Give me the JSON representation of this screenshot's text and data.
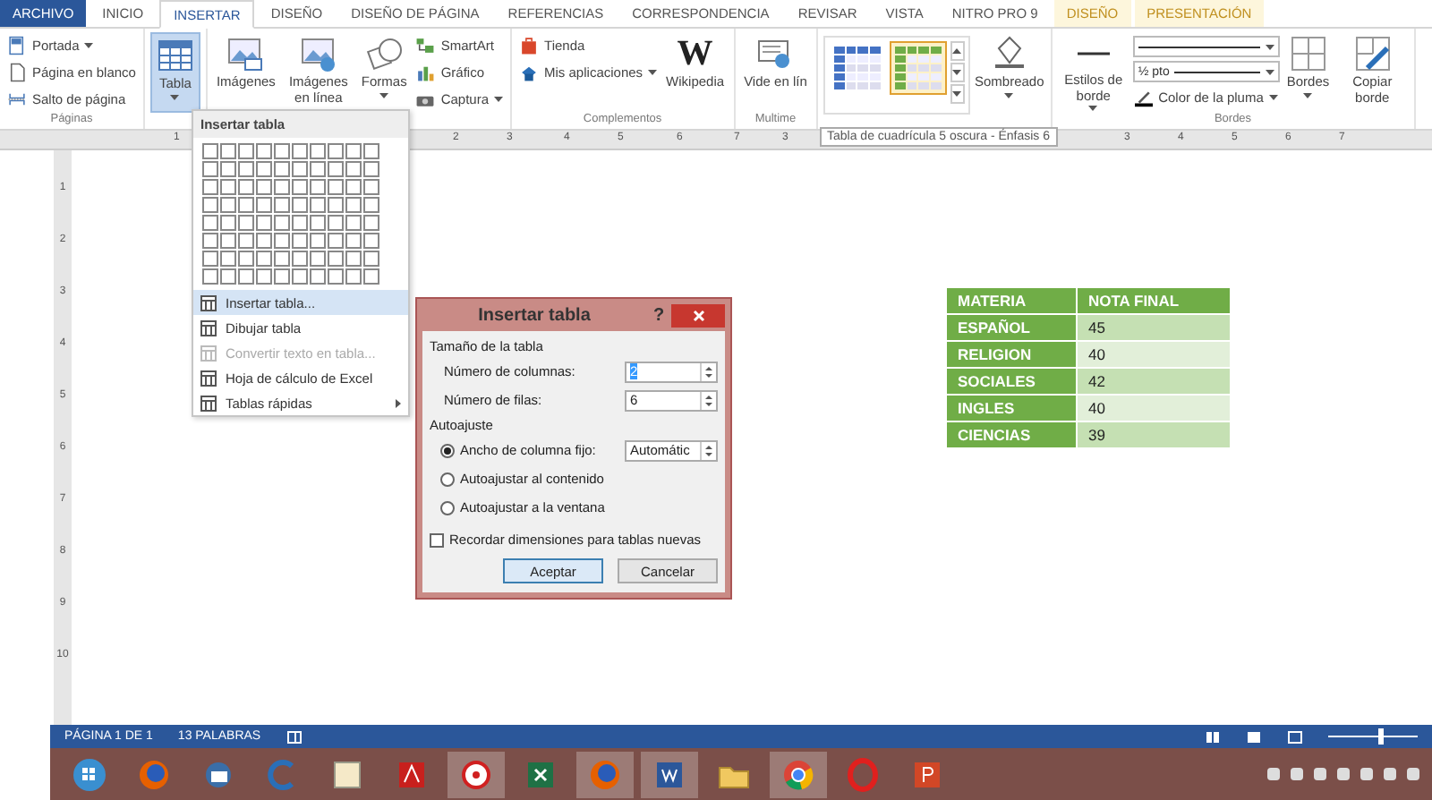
{
  "tabs": [
    {
      "label": "ARCHIVO",
      "kind": "file",
      "selected": false
    },
    {
      "label": "INICIO",
      "kind": "normal",
      "selected": false
    },
    {
      "label": "INSERTAR",
      "kind": "normal",
      "selected": true
    },
    {
      "label": "DISEÑO",
      "kind": "normal",
      "selected": false
    },
    {
      "label": "DISEÑO DE PÁGINA",
      "kind": "normal",
      "selected": false
    },
    {
      "label": "REFERENCIAS",
      "kind": "normal",
      "selected": false
    },
    {
      "label": "CORRESPONDENCIA",
      "kind": "normal",
      "selected": false
    },
    {
      "label": "REVISAR",
      "kind": "normal",
      "selected": false
    },
    {
      "label": "VISTA",
      "kind": "normal",
      "selected": false
    },
    {
      "label": "NITRO PRO 9",
      "kind": "normal",
      "selected": false
    },
    {
      "label": "DISEÑO",
      "kind": "contextual",
      "selected": false
    },
    {
      "label": "PRESENTACIÓN",
      "kind": "contextual",
      "selected": false
    }
  ],
  "ribbon_groups": [
    {
      "label": "Páginas",
      "columns": [
        {
          "kind": "stack",
          "items": [
            {
              "text": "Portada",
              "dropdown": true
            },
            {
              "text": "Página en blanco",
              "dropdown": false
            },
            {
              "text": "Salto de página",
              "dropdown": false
            }
          ]
        }
      ]
    },
    {
      "columns": [
        {
          "kind": "large",
          "text": "Tabla",
          "dropdown": true,
          "pressed": true
        }
      ]
    },
    {
      "columns": [
        {
          "kind": "large",
          "text": "Imágenes",
          "dropdown": false,
          "pressed": false
        },
        {
          "kind": "large",
          "text": "Imágenes en línea",
          "dropdown": false,
          "pressed": false
        },
        {
          "kind": "large",
          "text": "Formas",
          "dropdown": true,
          "pressed": false
        },
        {
          "kind": "stack",
          "items": [
            {
              "text": "SmartArt",
              "dropdown": false
            },
            {
              "text": "Gráfico",
              "dropdown": false
            },
            {
              "text": "Captura",
              "dropdown": true
            }
          ]
        }
      ]
    },
    {
      "label": "Complementos",
      "columns": [
        {
          "kind": "stack",
          "items": [
            {
              "text": "Tienda",
              "dropdown": false
            },
            {
              "text": "Mis aplicaciones",
              "dropdown": true
            }
          ]
        },
        {
          "kind": "large",
          "text": "Wikipedia",
          "logo": "W",
          "dropdown": false,
          "pressed": false
        }
      ]
    },
    {
      "label": "Multime",
      "columns": [
        {
          "kind": "large",
          "text": "Vide en lín",
          "dropdown": false,
          "pressed": false
        }
      ]
    },
    {
      "columns": [
        {
          "kind": "gallery",
          "styles": [
            {
              "color": "#4472c4",
              "selected": false
            },
            {
              "color": "#70ad47",
              "selected": true
            }
          ]
        },
        {
          "kind": "large",
          "text": "Sombreado",
          "dropdown": true,
          "pressed": false
        }
      ]
    },
    {
      "label": "Bordes",
      "columns": [
        {
          "kind": "large",
          "text": "Estilos de borde",
          "dropdown": true,
          "pressed": false
        },
        {
          "kind": "pen",
          "weight": "½ pto",
          "pen_color": "Color de la pluma"
        },
        {
          "kind": "large",
          "text": "Bordes",
          "dropdown": true,
          "pressed": false
        },
        {
          "kind": "large",
          "text": "Copiar borde",
          "dropdown": false,
          "pressed": false
        }
      ]
    }
  ],
  "ruler": {
    "marks": [
      "1",
      "2",
      "3",
      "4",
      "5",
      "6",
      "7",
      "3",
      "3",
      "4",
      "5",
      "6",
      "7"
    ]
  },
  "vertical_ruler": {
    "marks": [
      "1",
      "2",
      "3",
      "4",
      "5",
      "6",
      "7",
      "8",
      "9",
      "10"
    ]
  },
  "tooltip": "Tabla de cuadrícula 5 oscura - Énfasis 6",
  "table_menu": {
    "header": "Insertar tabla",
    "items": [
      {
        "label": "Insertar tabla...",
        "highlighted": true,
        "disabled": false,
        "submenu": false
      },
      {
        "label": "Dibujar tabla",
        "highlighted": false,
        "disabled": false,
        "submenu": false
      },
      {
        "label": "Convertir texto en tabla...",
        "highlighted": false,
        "disabled": true,
        "submenu": false
      },
      {
        "label": "Hoja de cálculo de Excel",
        "highlighted": false,
        "disabled": false,
        "submenu": false
      },
      {
        "label": "Tablas rápidas",
        "highlighted": false,
        "disabled": false,
        "submenu": true
      }
    ]
  },
  "dialog": {
    "title": "Insertar tabla",
    "help": "?",
    "size_section": "Tamaño de la tabla",
    "fields": [
      {
        "label": "Número de columnas:",
        "value": "2",
        "focused": true
      },
      {
        "label": "Número de filas:",
        "value": "6",
        "focused": false
      }
    ],
    "autofit_section": "Autoajuste",
    "options": [
      {
        "label": "Ancho de columna fijo:",
        "selected": true,
        "value": "Automátic"
      },
      {
        "label": "Autoajustar al contenido",
        "selected": false
      },
      {
        "label": "Autoajustar a la ventana",
        "selected": false
      }
    ],
    "remember": {
      "label": "Recordar dimensiones para tablas nuevas",
      "checked": false
    },
    "buttons": [
      {
        "label": "Aceptar",
        "default": true
      },
      {
        "label": "Cancelar",
        "default": false
      }
    ]
  },
  "grades_table": {
    "columns": [
      "MATERIA",
      "NOTA FINAL"
    ],
    "rows": [
      [
        "ESPAÑOL",
        "45"
      ],
      [
        "RELIGION",
        "40"
      ],
      [
        "SOCIALES",
        "42"
      ],
      [
        "INGLES",
        "40"
      ],
      [
        "CIENCIAS",
        "39"
      ]
    ]
  },
  "status_bar": {
    "page": "PÁGINA 1 DE 1",
    "words": "13 PALABRAS",
    "zoom": {
      "level": 0.55
    }
  },
  "taskbar": {
    "buttons": [
      {
        "kind": "start",
        "highlighted": false
      },
      {
        "kind": "firefox",
        "highlighted": false
      },
      {
        "kind": "mail",
        "highlighted": false
      },
      {
        "kind": "ccleaner",
        "highlighted": false
      },
      {
        "kind": "document",
        "highlighted": false
      },
      {
        "kind": "pdf",
        "highlighted": false
      },
      {
        "kind": "disc",
        "highlighted": true
      },
      {
        "kind": "excel",
        "highlighted": false
      },
      {
        "kind": "firefox",
        "highlighted": true
      },
      {
        "kind": "word",
        "highlighted": true
      },
      {
        "kind": "folder",
        "highlighted": false
      },
      {
        "kind": "chrome",
        "highlighted": true
      },
      {
        "kind": "opera",
        "highlighted": false
      },
      {
        "kind": "powerpoint",
        "highlighted": false
      }
    ]
  }
}
